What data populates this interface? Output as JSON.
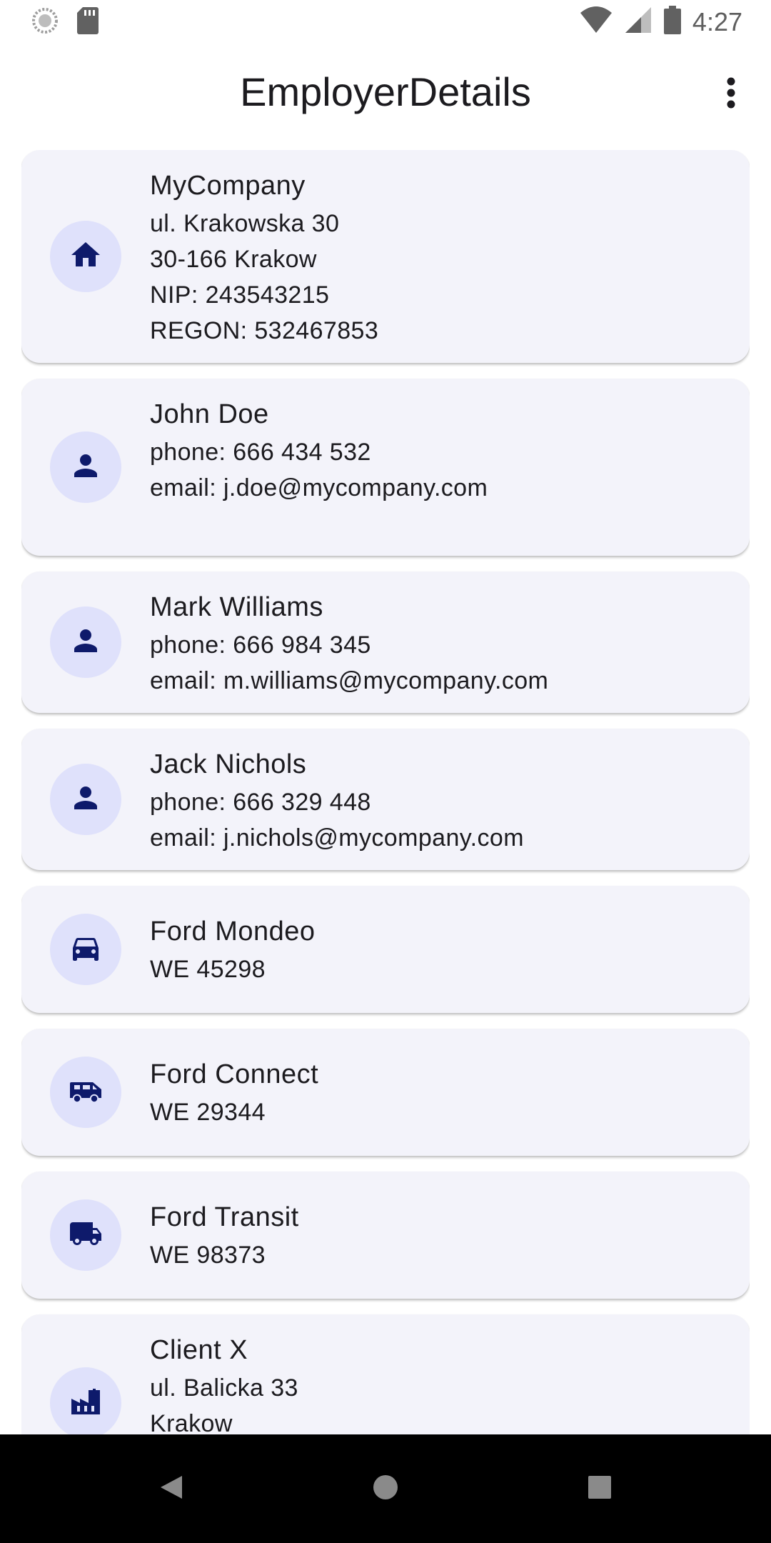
{
  "status_bar": {
    "time": "4:27",
    "icons": [
      "sync-icon",
      "sd-card-icon",
      "wifi-icon",
      "signal-icon",
      "battery-icon"
    ]
  },
  "app_bar": {
    "title": "EmployerDetails",
    "menu_icon": "more-vert-icon"
  },
  "cards": [
    {
      "icon": "home-icon",
      "title": "MyCompany",
      "lines": [
        "ul. Krakowska 30",
        "30-166 Krakow",
        "NIP: 243543215",
        "REGON: 532467853"
      ]
    },
    {
      "icon": "person-icon",
      "title": "John Doe",
      "lines": [
        "phone: 666 434 532",
        "email: j.doe@mycompany.com"
      ]
    },
    {
      "icon": "person-icon",
      "title": "Mark Williams",
      "lines": [
        "phone: 666 984 345",
        "email: m.williams@mycompany.com"
      ]
    },
    {
      "icon": "person-icon",
      "title": "Jack Nichols",
      "lines": [
        "phone: 666 329 448",
        "email: j.nichols@mycompany.com"
      ]
    },
    {
      "icon": "car-icon",
      "title": "Ford Mondeo",
      "lines": [
        "WE 45298"
      ]
    },
    {
      "icon": "van-icon",
      "title": "Ford Connect",
      "lines": [
        "WE 29344"
      ]
    },
    {
      "icon": "truck-icon",
      "title": "Ford Transit",
      "lines": [
        "WE 98373"
      ]
    },
    {
      "icon": "factory-icon",
      "title": "Client X",
      "lines": [
        "ul. Balicka 33",
        "Krakow"
      ]
    }
  ],
  "nav_bar": {
    "buttons": [
      "back-icon",
      "home-circle-icon",
      "recents-icon"
    ]
  },
  "colors": {
    "icon": "#0e1a6b",
    "icon_bg": "#dfe1fb",
    "card_bg": "#f3f3fa"
  }
}
